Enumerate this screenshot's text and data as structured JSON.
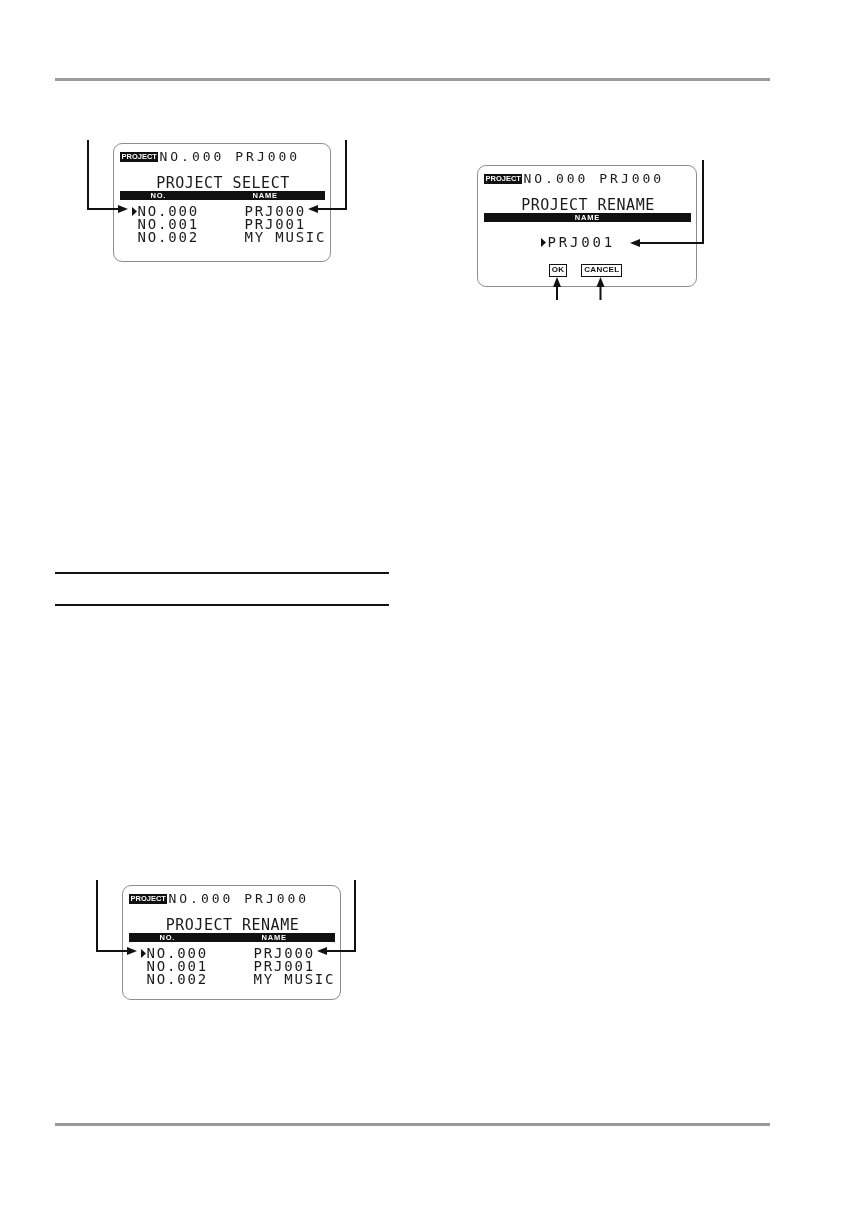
{
  "left_column": [
    {
      "kind": "project_list",
      "header": {
        "tag": "PROJECT",
        "text": "NO.000 PRJ000"
      },
      "title": "PROJECT SELECT",
      "columns": [
        "NO.",
        "NAME"
      ],
      "rows": [
        {
          "number": "NO.000",
          "name": "PRJ000",
          "selected": true
        },
        {
          "number": "NO.001",
          "name": "PRJ001",
          "selected": false
        },
        {
          "number": "NO.002",
          "name": "MY MUSIC",
          "selected": false
        }
      ]
    },
    {
      "kind": "project_list",
      "header": {
        "tag": "PROJECT",
        "text": "NO.000 PRJ000"
      },
      "title": "PROJECT RENAME",
      "columns": [
        "NO.",
        "NAME"
      ],
      "rows": [
        {
          "number": "NO.000",
          "name": "PRJ000",
          "selected": true
        },
        {
          "number": "NO.001",
          "name": "PRJ001",
          "selected": false
        },
        {
          "number": "NO.002",
          "name": "MY MUSIC",
          "selected": false
        }
      ]
    }
  ],
  "right_column": [
    {
      "kind": "rename",
      "header": {
        "tag": "PROJECT",
        "text": "NO.000 PRJ000"
      },
      "title": "PROJECT RENAME",
      "columns": [
        "NAME"
      ],
      "value": "PRJ001",
      "buttons": [
        "OK",
        "CANCEL"
      ]
    }
  ]
}
